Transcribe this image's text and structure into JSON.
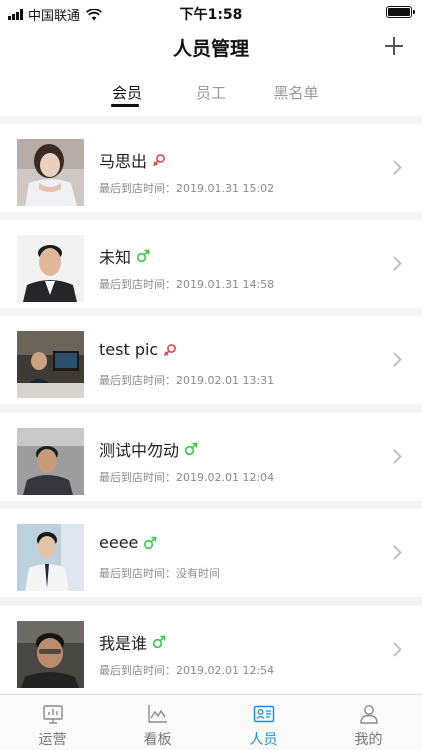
{
  "status_bar": {
    "carrier": "中国联通",
    "time": "下午1:58"
  },
  "nav": {
    "title": "人员管理",
    "add_icon": "plus-icon"
  },
  "tabs": [
    {
      "label": "会员",
      "active": true
    },
    {
      "label": "员工",
      "active": false
    },
    {
      "label": "黑名单",
      "active": false
    }
  ],
  "members": [
    {
      "name": "马思出",
      "gender": "female",
      "last_visit_label": "最后到店时间：",
      "last_visit": "2019.01.31 15:02"
    },
    {
      "name": "未知",
      "gender": "male",
      "last_visit_label": "最后到店时间：",
      "last_visit": "2019.01.31 14:58"
    },
    {
      "name": "test pic",
      "gender": "female",
      "last_visit_label": "最后到店时间：",
      "last_visit": "2019.02.01 13:31"
    },
    {
      "name": "测试中勿动",
      "gender": "male",
      "last_visit_label": "最后到店时间：",
      "last_visit": "2019.02.01 12:04"
    },
    {
      "name": "eeee",
      "gender": "male",
      "last_visit_label": "最后到店时间：",
      "last_visit": "没有时间"
    },
    {
      "name": "我是谁",
      "gender": "male",
      "last_visit_label": "最后到店时间：",
      "last_visit": "2019.02.01 12:54"
    }
  ],
  "tab_bar": [
    {
      "label": "运营",
      "icon": "operations-icon",
      "active": false
    },
    {
      "label": "看板",
      "icon": "dashboard-icon",
      "active": false
    },
    {
      "label": "人员",
      "icon": "people-icon",
      "active": true
    },
    {
      "label": "我的",
      "icon": "profile-icon",
      "active": false
    }
  ],
  "colors": {
    "male": "#3cc44a",
    "female": "#e0454a",
    "accent": "#1f8ee0"
  }
}
